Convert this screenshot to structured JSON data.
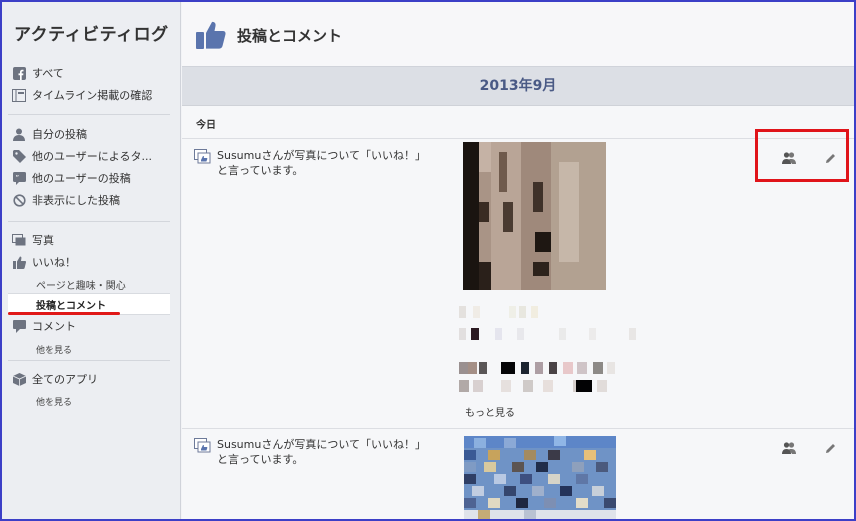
{
  "sidebar": {
    "title": "アクティビティログ",
    "items": {
      "all": "すべて",
      "timeline_review": "タイムライン掲載の確認",
      "own_posts": "自分の投稿",
      "tagged_posts": "他のユーザーによるタ...",
      "others_posts": "他のユーザーの投稿",
      "hidden_posts": "非表示にした投稿",
      "photos": "写真",
      "likes": "いいね！",
      "pages_interests": "ページと趣味・関心",
      "posts_comments": "投稿とコメント",
      "comments": "コメント",
      "see_more_1": "他を見る",
      "all_apps": "全てのアプリ",
      "see_more_2": "他を見る"
    }
  },
  "header": {
    "title": "投稿とコメント",
    "icon": "thumbs-up-icon"
  },
  "month": "2013年9月",
  "day_label": "今日",
  "stories": [
    {
      "text_line1": "Susumuさんが写真について「いいね！」",
      "text_line2": "と言っています。",
      "more": "もっと見る"
    },
    {
      "text_line1": "Susumuさんが写真について「いいね！」",
      "text_line2": "と言っています。"
    }
  ],
  "colors": {
    "accent": "#4a5a85",
    "highlight": "#e0141a",
    "frame": "#3c3fc7"
  }
}
